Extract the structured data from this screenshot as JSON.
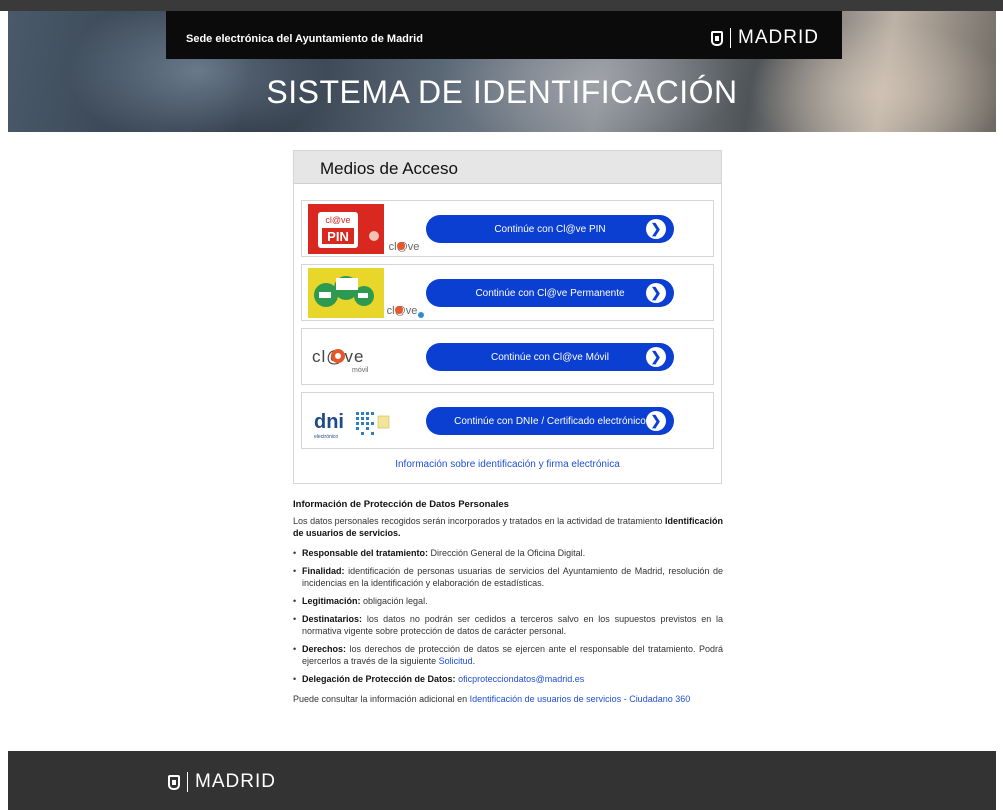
{
  "header": {
    "site_name": "Sede electrónica del Ayuntamiento de Madrid",
    "logo_text": "MADRID",
    "title": "SISTEMA DE IDENTIFICACIÓN"
  },
  "access": {
    "heading": "Medios de Acceso",
    "options": [
      {
        "label": "Continúe con Cl@ve PIN",
        "logo_text": "PIN",
        "logo_sub": "cl@ve"
      },
      {
        "label": "Continúe con Cl@ve Permanente",
        "logo_sub": "cl@ve"
      },
      {
        "label": "Continúe con Cl@ve Móvil",
        "logo_text": "cl@ve",
        "logo_sub": "móvil"
      },
      {
        "label": "Continúe con DNIe / Certificado electrónico",
        "logo_text": "dni",
        "logo_sub": "electrónico"
      }
    ],
    "info_link": "Información sobre identificación y firma electrónica"
  },
  "privacy": {
    "heading": "Información de Protección de Datos Personales",
    "intro": "Los datos personales recogidos serán incorporados y tratados en la actividad de tratamiento",
    "intro_bold": "Identificación de usuarios de servicios.",
    "items": [
      {
        "label": "Responsable del tratamiento:",
        "text": " Dirección General de la Oficina Digital."
      },
      {
        "label": "Finalidad:",
        "text": " identificación de personas usuarias de servicios del Ayuntamiento de Madrid, resolución de incidencias en la identificación y elaboración de estadísticas."
      },
      {
        "label": "Legitimación:",
        "text": " obligación legal."
      },
      {
        "label": "Destinatarios:",
        "text": " los datos no podrán ser cedidos a terceros salvo en los supuestos previstos en la normativa vigente sobre protección de datos de carácter personal."
      },
      {
        "label": "Derechos:",
        "text": " los derechos de protección de datos se ejercen ante el responsable del tratamiento. Podrá ejercerlos a través de la siguiente ",
        "link": "Solicitud",
        "after": "."
      },
      {
        "label": "Delegación de Protección de Datos:",
        "text": " ",
        "link": "oficprotecciondatos@madrid.es"
      }
    ],
    "footer_text": "Puede consultar la información adicional en ",
    "footer_link": "Identificación de usuarios de servicios - Ciudadano 360"
  },
  "footer": {
    "logo_text": "MADRID"
  }
}
